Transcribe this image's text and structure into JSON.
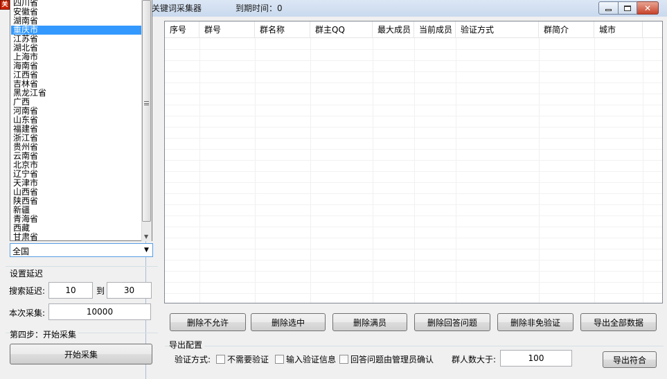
{
  "window": {
    "app_icon_text": "关",
    "title": "关键词采集器",
    "expire_label": "到期时间：0"
  },
  "province_list": {
    "items": [
      "四川省",
      "安徽省",
      "湖南省",
      "重庆市",
      "江苏省",
      "湖北省",
      "上海市",
      "海南省",
      "江西省",
      "吉林省",
      "黑龙江省",
      "广西",
      "河南省",
      "山东省",
      "福建省",
      "浙江省",
      "贵州省",
      "云南省",
      "北京市",
      "辽宁省",
      "天津市",
      "山西省",
      "陕西省",
      "新疆",
      "青海省",
      "西藏",
      "甘肃省"
    ],
    "selected": "重庆市",
    "combo_value": "全国"
  },
  "delay": {
    "group_title": "设置延迟",
    "search_delay_label": "搜索延迟:",
    "from_value": "10",
    "to_label": "到",
    "to_value": "30",
    "collect_label": "本次采集:",
    "collect_value": "10000"
  },
  "step4": {
    "group_title": "第四步：开始采集",
    "start_button": "开始采集"
  },
  "table": {
    "columns": [
      "序号",
      "群号",
      "群名称",
      "群主QQ",
      "最大成员",
      "当前成员",
      "验证方式",
      "群简介",
      "城市"
    ],
    "rows": []
  },
  "actions": {
    "delete_disallowed": "删除不允许",
    "delete_selected": "删除选中",
    "delete_full": "删除满员",
    "delete_answer": "删除回答问题",
    "delete_non_free": "删除非免验证",
    "export_all": "导出全部数据"
  },
  "export_config": {
    "group_title": "导出配置",
    "verify_label": "验证方式:",
    "opt_no_verify": "不需要验证",
    "opt_input_info": "输入验证信息",
    "opt_answer_admin": "回答问题由管理员确认",
    "members_label": "群人数大于:",
    "members_value": "100",
    "export_match": "导出符合"
  }
}
